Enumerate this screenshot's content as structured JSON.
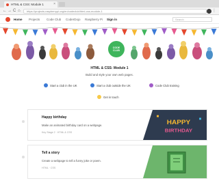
{
  "browser": {
    "tab_title": "HTML & CSS: Module 1",
    "tab_close": "×",
    "back": "←",
    "forward": "→",
    "reload": "C",
    "home": "⌂",
    "address": "https://projects.raspberrypi.org/en/codeclub/html-css-module-1",
    "menu": "⋮"
  },
  "site_nav": {
    "items": [
      {
        "label": "Home",
        "bold": true
      },
      {
        "label": "Projects",
        "bold": false
      },
      {
        "label": "Code Club",
        "bold": false
      },
      {
        "label": "CoderDojo",
        "bold": false
      },
      {
        "label": "Raspberry Pi",
        "bold": false
      },
      {
        "label": "Sign in",
        "bold": true
      }
    ],
    "search_placeholder": "Search"
  },
  "hero": {
    "badge_line1": "CODE",
    "badge_line2": "CLUB",
    "title": "HTML & CSS: Module 1",
    "subtitle": "Build and style your own web pages."
  },
  "actions": [
    {
      "label": "Start a club in the UK",
      "color": "#3a79d6"
    },
    {
      "label": "Start a club outside the UK",
      "color": "#3a79d6"
    },
    {
      "label": "Code Club training",
      "color": "#a05cc7"
    }
  ],
  "get_in_touch": "Get in touch",
  "projects": [
    {
      "title": "Happy birthday",
      "description": "Make an animated birthday card on a webpage.",
      "meta": "Key Stage 2 · HTML & CSS",
      "art_text": [
        "HAPPY",
        "BIRTHDAY"
      ],
      "colors": {
        "band": "#2e3b4f"
      }
    },
    {
      "title": "Tell a story",
      "description": "Create a webpage to tell a funny joke or poem.",
      "meta": "HTML · CSS",
      "colors": {
        "band": "#6db56c"
      }
    }
  ]
}
